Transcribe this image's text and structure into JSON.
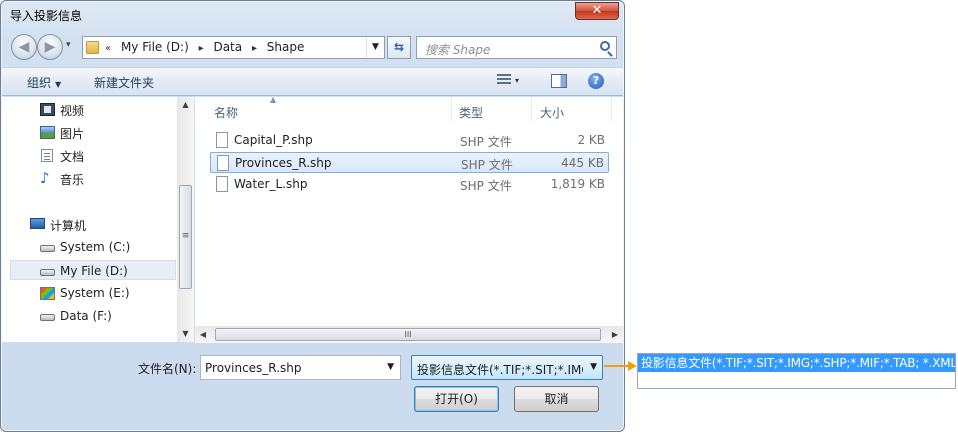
{
  "window": {
    "title": "导入投影信息",
    "close_glyph": "✕"
  },
  "nav": {
    "back_glyph": "◀",
    "forward_glyph": "▶",
    "history_glyph": "▾",
    "address": {
      "overflow": "«",
      "crumbs": [
        "My File (D:)",
        "Data",
        "Shape"
      ],
      "separator": "▸",
      "dropdown_glyph": "▼"
    },
    "refresh_glyph": "⇆",
    "search_placeholder": "搜索 Shape"
  },
  "toolbar": {
    "organize_label": "组织",
    "organize_arrow": "▼",
    "new_folder_label": "新建文件夹",
    "view_arrow": "▾",
    "help_glyph": "?"
  },
  "sidebar": {
    "items": [
      {
        "label": "视频",
        "icon": "video-icon"
      },
      {
        "label": "图片",
        "icon": "pictures-icon"
      },
      {
        "label": "文档",
        "icon": "documents-icon"
      },
      {
        "label": "音乐",
        "icon": "music-icon"
      },
      {
        "label": "计算机",
        "icon": "computer-icon"
      },
      {
        "label": "System (C:)",
        "icon": "drive-icon"
      },
      {
        "label": "My File (D:)",
        "icon": "drive-icon",
        "selected": true
      },
      {
        "label": "System (E:)",
        "icon": "windows-drive-icon"
      },
      {
        "label": "Data (F:)",
        "icon": "drive-icon"
      }
    ],
    "scroll": {
      "up": "▲",
      "down": "▼",
      "grip": "≡"
    }
  },
  "file_list": {
    "columns": {
      "name": "名称",
      "type": "类型",
      "size": "大小",
      "sort_glyph": "▲"
    },
    "rows": [
      {
        "name": "Capital_P.shp",
        "type": "SHP 文件",
        "size": "2 KB",
        "selected": false
      },
      {
        "name": "Provinces_R.shp",
        "type": "SHP 文件",
        "size": "445 KB",
        "selected": true
      },
      {
        "name": "Water_L.shp",
        "type": "SHP 文件",
        "size": "1,819 KB",
        "selected": false
      }
    ],
    "hscroll": {
      "left": "◀",
      "right": "▶",
      "grip": "III"
    }
  },
  "footer": {
    "filename_label": "文件名(N):",
    "filename_value": "Provinces_R.shp",
    "filename_arrow": "▼",
    "filter_value": "投影信息文件(*.TIF;*.SIT;*.IMG",
    "filter_arrow": "▼",
    "open_label": "打开(O)",
    "cancel_label": "取消"
  },
  "dropdown": {
    "option": "投影信息文件(*.TIF;*.SIT;*.IMG;*.SHP;*.MIF;*.TAB; *.XML)"
  },
  "colors": {
    "accent": "#3399ff",
    "callout": "#f39c12",
    "selection": "#d6e7fb"
  }
}
